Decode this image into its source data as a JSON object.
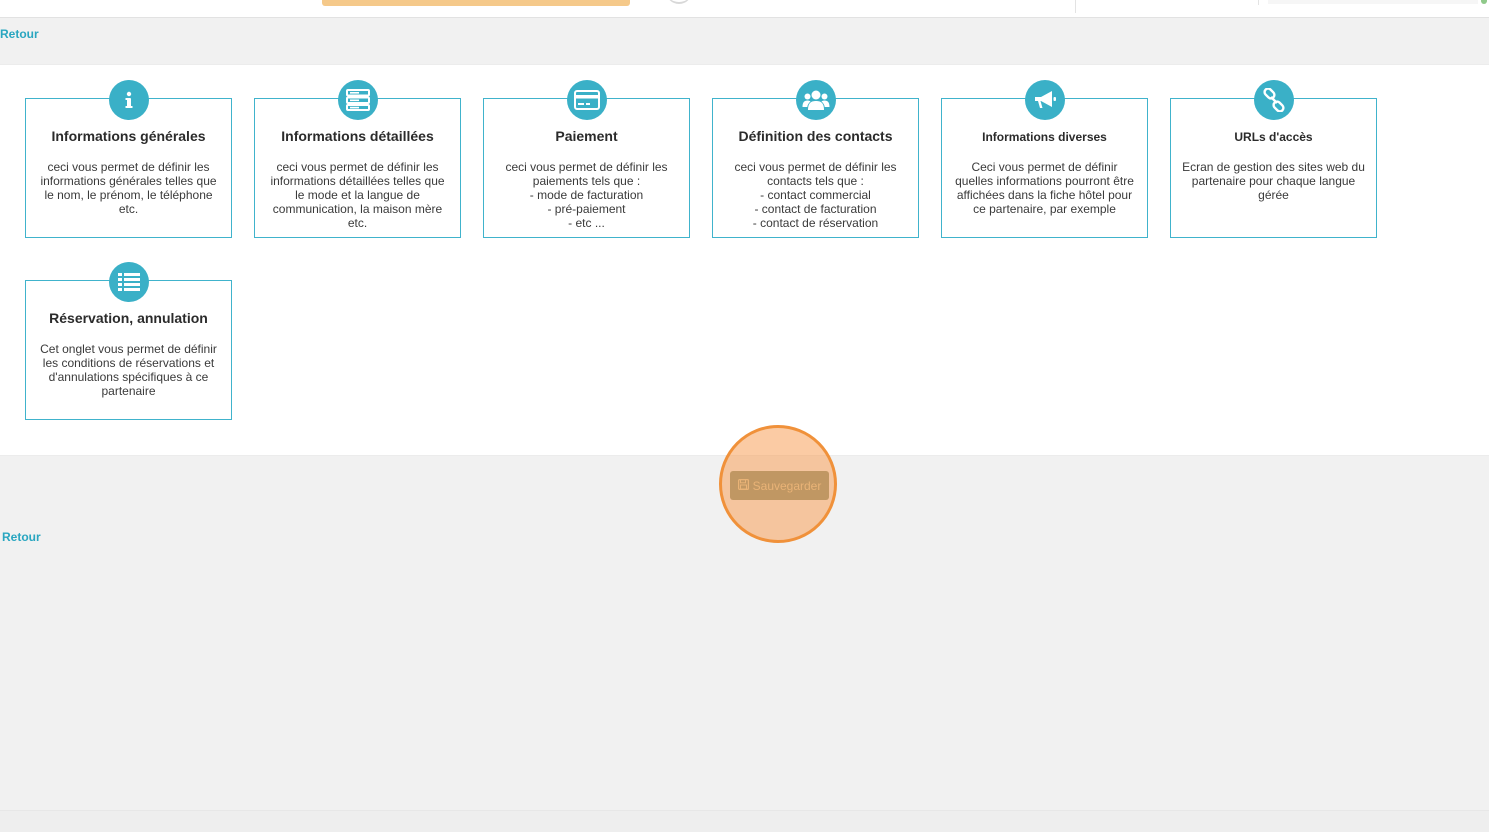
{
  "nav": {
    "back_label": "Retour",
    "back_label_bottom": "Retour"
  },
  "cards": [
    {
      "icon": "info-icon",
      "title": "Informations générales",
      "desc": "ceci vous permet de définir les informations générales telles que le nom, le prénom, le téléphone etc."
    },
    {
      "icon": "server-list-icon",
      "title": "Informations détaillées",
      "desc": "ceci vous permet de définir les informations détaillées telles que le mode et la langue de communication, la maison mère etc."
    },
    {
      "icon": "credit-card-icon",
      "title": "Paiement",
      "desc": "ceci vous permet de définir les paiements tels que :\n- mode de facturation\n- pré-paiement\n- etc ..."
    },
    {
      "icon": "users-icon",
      "title": "Définition des contacts",
      "desc": "ceci vous permet de définir les contacts tels que :\n- contact commercial\n- contact de facturation\n- contact de réservation"
    },
    {
      "icon": "megaphone-icon",
      "title": "Informations diverses",
      "desc": "Ceci vous permet de définir quelles informations pourront être affichées dans la fiche hôtel pour ce partenaire, par exemple"
    },
    {
      "icon": "link-icon",
      "title": "URLs d'accès",
      "desc": "Ecran de gestion des sites web du partenaire pour chaque langue gérée"
    },
    {
      "icon": "list-icon",
      "title": "Réservation, annulation",
      "desc": "Cet onglet vous permet de définir les conditions de réservations et d'annulations spécifiques à ce partenaire"
    }
  ],
  "actions": {
    "save_label": "Sauvegarder",
    "save_icon": "floppy-disk-icon"
  },
  "colors": {
    "accent": "#3ab0c7",
    "card_border": "#40b3cc",
    "highlight": "#f0913a"
  }
}
